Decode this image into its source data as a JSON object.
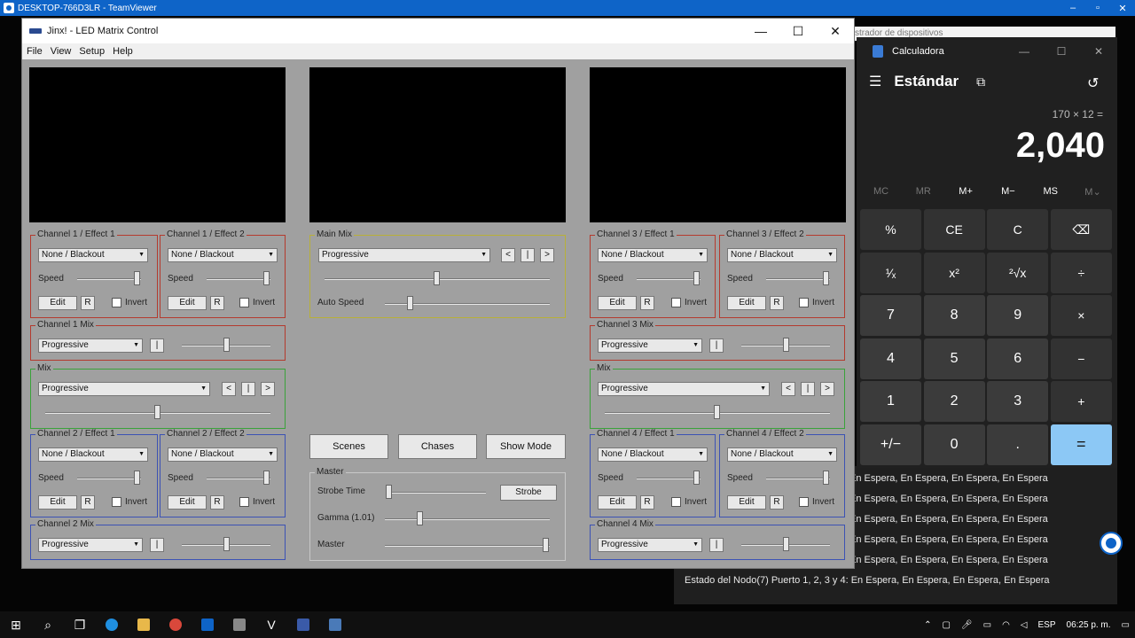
{
  "teamviewer": {
    "title": "DESKTOP-766D3LR - TeamViewer",
    "minimize": "–",
    "restore": "▫",
    "close": "✕"
  },
  "behind_window": {
    "title": "strador de dispositivos"
  },
  "jinx": {
    "title": "Jinx! - LED Matrix Control",
    "minimize": "—",
    "maximize": "☐",
    "close": "✕",
    "menu": [
      "File",
      "View",
      "Setup",
      "Help"
    ],
    "groups": {
      "ch1e1": {
        "label": "Channel 1 / Effect 1",
        "combo": "None / Blackout",
        "speed": "Speed",
        "edit": "Edit",
        "r": "R",
        "invert": "Invert"
      },
      "ch1e2": {
        "label": "Channel 1 / Effect 2",
        "combo": "None / Blackout",
        "speed": "Speed",
        "edit": "Edit",
        "r": "R",
        "invert": "Invert"
      },
      "ch1mix": {
        "label": "Channel 1 Mix",
        "combo": "Progressive",
        "pipe": "|"
      },
      "mix_left": {
        "label": "Mix",
        "combo": "Progressive",
        "prev": "<",
        "pipe": "|",
        "next": ">"
      },
      "ch2e1": {
        "label": "Channel 2 / Effect 1",
        "combo": "None / Blackout",
        "speed": "Speed",
        "edit": "Edit",
        "r": "R",
        "invert": "Invert"
      },
      "ch2e2": {
        "label": "Channel 2 / Effect 2",
        "combo": "None / Blackout",
        "speed": "Speed",
        "edit": "Edit",
        "r": "R",
        "invert": "Invert"
      },
      "ch2mix": {
        "label": "Channel 2 Mix",
        "combo": "Progressive",
        "pipe": "|"
      },
      "mainmix": {
        "label": "Main Mix",
        "combo": "Progressive",
        "prev": "<",
        "pipe": "|",
        "next": ">",
        "auto_speed": "Auto Speed"
      },
      "ch3e1": {
        "label": "Channel 3 / Effect 1",
        "combo": "None / Blackout",
        "speed": "Speed",
        "edit": "Edit",
        "r": "R",
        "invert": "Invert"
      },
      "ch3e2": {
        "label": "Channel 3 / Effect 2",
        "combo": "None / Blackout",
        "speed": "Speed",
        "edit": "Edit",
        "r": "R",
        "invert": "Invert"
      },
      "ch3mix": {
        "label": "Channel 3 Mix",
        "combo": "Progressive",
        "pipe": "|"
      },
      "mix_right": {
        "label": "Mix",
        "combo": "Progressive",
        "prev": "<",
        "pipe": "|",
        "next": ">"
      },
      "ch4e1": {
        "label": "Channel 4 / Effect 1",
        "combo": "None / Blackout",
        "speed": "Speed",
        "edit": "Edit",
        "r": "R",
        "invert": "Invert"
      },
      "ch4e2": {
        "label": "Channel 4 / Effect 2",
        "combo": "None / Blackout",
        "speed": "Speed",
        "edit": "Edit",
        "r": "R",
        "invert": "Invert"
      },
      "ch4mix": {
        "label": "Channel 4 Mix",
        "combo": "Progressive",
        "pipe": "|"
      },
      "master": {
        "label": "Master",
        "strobe_time": "Strobe Time",
        "strobe_btn": "Strobe",
        "gamma": "Gamma (1.01)",
        "master": "Master"
      }
    },
    "buttons": {
      "scenes": "Scenes",
      "chases": "Chases",
      "show_mode": "Show Mode"
    }
  },
  "calculator": {
    "title": "Calculadora",
    "mode": "Estándar",
    "expression": "170 × 12 =",
    "display": "2,040",
    "memory": [
      "MC",
      "MR",
      "M+",
      "M−",
      "MS",
      "M⌄"
    ],
    "keys": [
      "%",
      "CE",
      "C",
      "⌫",
      "¹⁄ₓ",
      "x²",
      "²√x",
      "÷",
      "7",
      "8",
      "9",
      "×",
      "4",
      "5",
      "6",
      "−",
      "1",
      "2",
      "3",
      "+",
      "+/−",
      "0",
      ".",
      "="
    ]
  },
  "log": {
    "lines": [
      "En Espera, En Espera, En Espera, En Espera",
      "En Espera, En Espera, En Espera, En Espera",
      "En Espera, En Espera, En Espera, En Espera",
      "En Espera, En Espera, En Espera, En Espera",
      "En Espera, En Espera, En Espera, En Espera",
      "Estado del Nodo(7) Puerto 1, 2, 3 y 4: En Espera, En Espera, En Espera, En Espera"
    ]
  },
  "taskbar": {
    "lang": "ESP",
    "time": "06:25 p. m."
  }
}
